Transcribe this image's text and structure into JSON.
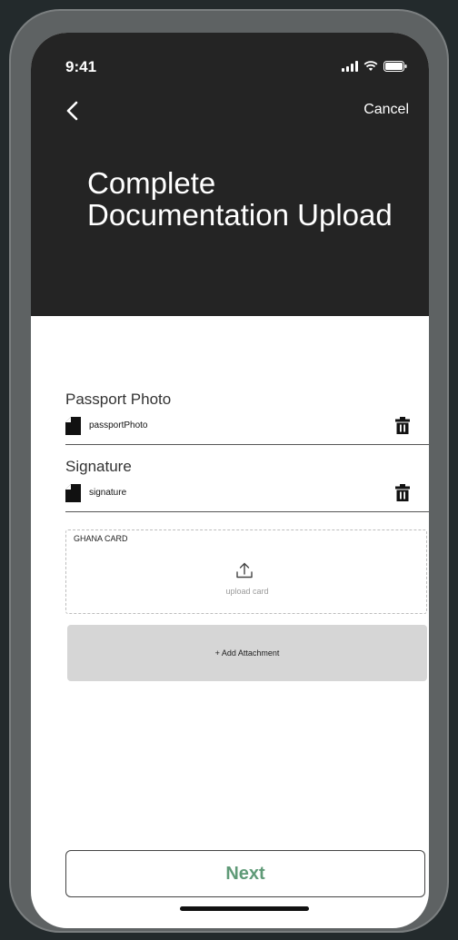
{
  "status_bar": {
    "time": "9:41"
  },
  "nav": {
    "cancel_label": "Cancel"
  },
  "page": {
    "title": "Complete Documentation Upload"
  },
  "documents": [
    {
      "label": "Passport Photo",
      "file_name": "passportPhoto",
      "file_icon": "file-icon",
      "action_icon": "trash-icon"
    },
    {
      "label": "Signature",
      "file_name": "signature",
      "file_icon": "file-icon",
      "action_icon": "trash-icon"
    }
  ],
  "upload": {
    "title": "GHANA CARD",
    "hint": "upload card",
    "icon": "upload-icon"
  },
  "actions": {
    "add_attachment_label": "+ Add Attachment",
    "next_label": "Next"
  },
  "colors": {
    "header_bg": "#242424",
    "next_text": "#5f9a77",
    "attachment_bg": "#d6d6d6",
    "page_bg": "#232a2c"
  }
}
